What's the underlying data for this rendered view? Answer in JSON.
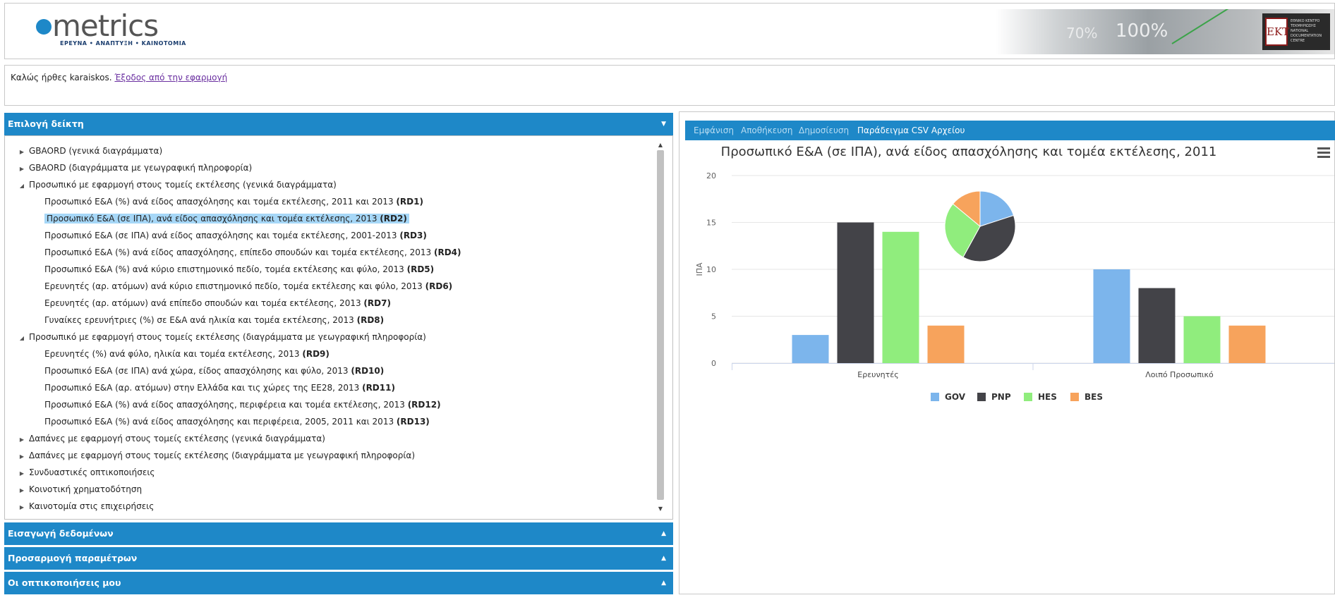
{
  "header": {
    "logo_text": "metrics",
    "logo_subtitle": "ΕΡΕΥΝΑ • ΑΝΑΠΤΥΞΗ • ΚΑΙΝΟΤΟΜΙΑ",
    "banner_text_1": "70%",
    "banner_text_2": "100%",
    "partner_logo": "EKT",
    "partner_text": "ΕΘΝΙΚΟ ΚΕΝΤΡΟ ΤΕΚΜΗΡΙΩΣΗΣ NATIONAL DOCUMENTATION CENTRE"
  },
  "welcome": {
    "greeting": "Καλώς ήρθες karaiskos.",
    "logout_link": "Έξοδος από την εφαρμογή"
  },
  "left_panel": {
    "indicator_title": "Επιλογή δείκτη",
    "tree": [
      {
        "label": "GBAORD (γενικά διαγράμματα)",
        "expanded": false
      },
      {
        "label": "GBAORD (διαγράμματα με γεωγραφική πληροφορία)",
        "expanded": false
      },
      {
        "label": "Προσωπικό με εφαρμογή στους τομείς εκτέλεσης (γενικά διαγράμματα)",
        "expanded": true,
        "children": [
          {
            "text": "Προσωπικό Ε&Α (%) ανά είδος απασχόλησης και τομέα εκτέλεσης, 2011 και 2013",
            "code": "RD1"
          },
          {
            "text": "Προσωπικό Ε&Α (σε ΙΠΑ), ανά είδος απασχόλησης και τομέα εκτέλεσης, 2013",
            "code": "RD2",
            "selected": true
          },
          {
            "text": "Προσωπικό Ε&Α (σε ΙΠΑ) ανά είδος απασχόλησης και τομέα εκτέλεσης, 2001-2013",
            "code": "RD3"
          },
          {
            "text": "Προσωπικό Ε&Α (%) ανά είδος απασχόλησης, επίπεδο σπουδών και τομέα εκτέλεσης, 2013",
            "code": "RD4"
          },
          {
            "text": "Προσωπικό Ε&Α (%) ανά κύριο επιστημονικό πεδίο, τομέα εκτέλεσης και φύλο, 2013",
            "code": "RD5"
          },
          {
            "text": "Ερευνητές (αρ. ατόμων) ανά κύριο επιστημονικό πεδίο, τομέα εκτέλεσης και φύλο, 2013",
            "code": "RD6"
          },
          {
            "text": "Ερευνητές (αρ. ατόμων) ανά επίπεδο σπουδών και τομέα εκτέλεσης, 2013",
            "code": "RD7"
          },
          {
            "text": "Γυναίκες ερευνήτριες (%) σε Ε&Α ανά ηλικία και τομέα εκτέλεσης, 2013",
            "code": "RD8"
          }
        ]
      },
      {
        "label": "Προσωπικό με εφαρμογή στους τομείς εκτέλεσης (διαγράμματα με γεωγραφική πληροφορία)",
        "expanded": true,
        "children": [
          {
            "text": "Ερευνητές (%) ανά φύλο, ηλικία και τομέα εκτέλεσης, 2013",
            "code": "RD9"
          },
          {
            "text": "Προσωπικό Ε&Α (σε ΙΠΑ) ανά χώρα, είδος απασχόλησης και φύλο, 2013",
            "code": "RD10"
          },
          {
            "text": "Προσωπικό Ε&Α (αρ. ατόμων) στην Ελλάδα και τις χώρες της ΕΕ28, 2013",
            "code": "RD11"
          },
          {
            "text": "Προσωπικό Ε&Α (%) ανά είδος απασχόλησης, περιφέρεια και τομέα εκτέλεσης, 2013",
            "code": "RD12"
          },
          {
            "text": "Προσωπικό Ε&Α (%) ανά είδος απασχόλησης και περιφέρεια, 2005, 2011 και 2013",
            "code": "RD13"
          }
        ]
      },
      {
        "label": "Δαπάνες με εφαρμογή στους τομείς εκτέλεσης (γενικά διαγράμματα)",
        "expanded": false
      },
      {
        "label": "Δαπάνες με εφαρμογή στους τομείς εκτέλεσης (διαγράμματα με γεωγραφική πληροφορία)",
        "expanded": false
      },
      {
        "label": "Συνδυαστικές οπτικοποιήσεις",
        "expanded": false
      },
      {
        "label": "Κοινοτική χρηματοδότηση",
        "expanded": false
      },
      {
        "label": "Καινοτομία στις επιχειρήσεις",
        "expanded": false
      }
    ],
    "data_input_title": "Εισαγωγή δεδομένων",
    "params_title": "Προσαρμογή παραμέτρων",
    "my_viz_title": "Οι οπτικοποιήσεις μου"
  },
  "toolbar": {
    "show": "Εμφάνιση",
    "save": "Αποθήκευση",
    "publish": "Δημοσίευση",
    "csv_example": "Παράδειγμα CSV Αρχείου"
  },
  "colors": {
    "accent": "#1e88c8",
    "GOV": "#7cb5ec",
    "PNP": "#434348",
    "HES": "#90ed7d",
    "BES": "#f7a35c"
  },
  "chart_data": {
    "type": "bar",
    "title": "Προσωπικό Ε&Α (σε ΙΠΑ), ανά είδος απασχόλησης και τομέα εκτέλεσης, 2011",
    "ylabel": "ΙΠΑ",
    "xlabel": "",
    "ylim": [
      0,
      20
    ],
    "yticks": [
      "0",
      "5",
      "10",
      "15",
      "20"
    ],
    "categories": [
      "Ερευνητές",
      "Λοιπό Προσωπικό"
    ],
    "series": [
      {
        "name": "GOV",
        "values": [
          3,
          10
        ]
      },
      {
        "name": "PNP",
        "values": [
          15,
          8
        ]
      },
      {
        "name": "HES",
        "values": [
          14,
          5
        ]
      },
      {
        "name": "BES",
        "values": [
          4,
          4
        ]
      }
    ],
    "pie": {
      "labels": [
        "GOV",
        "PNP",
        "HES",
        "BES"
      ],
      "values": [
        20,
        38,
        28,
        14
      ]
    },
    "legend": "bottom-center",
    "grid": true
  }
}
